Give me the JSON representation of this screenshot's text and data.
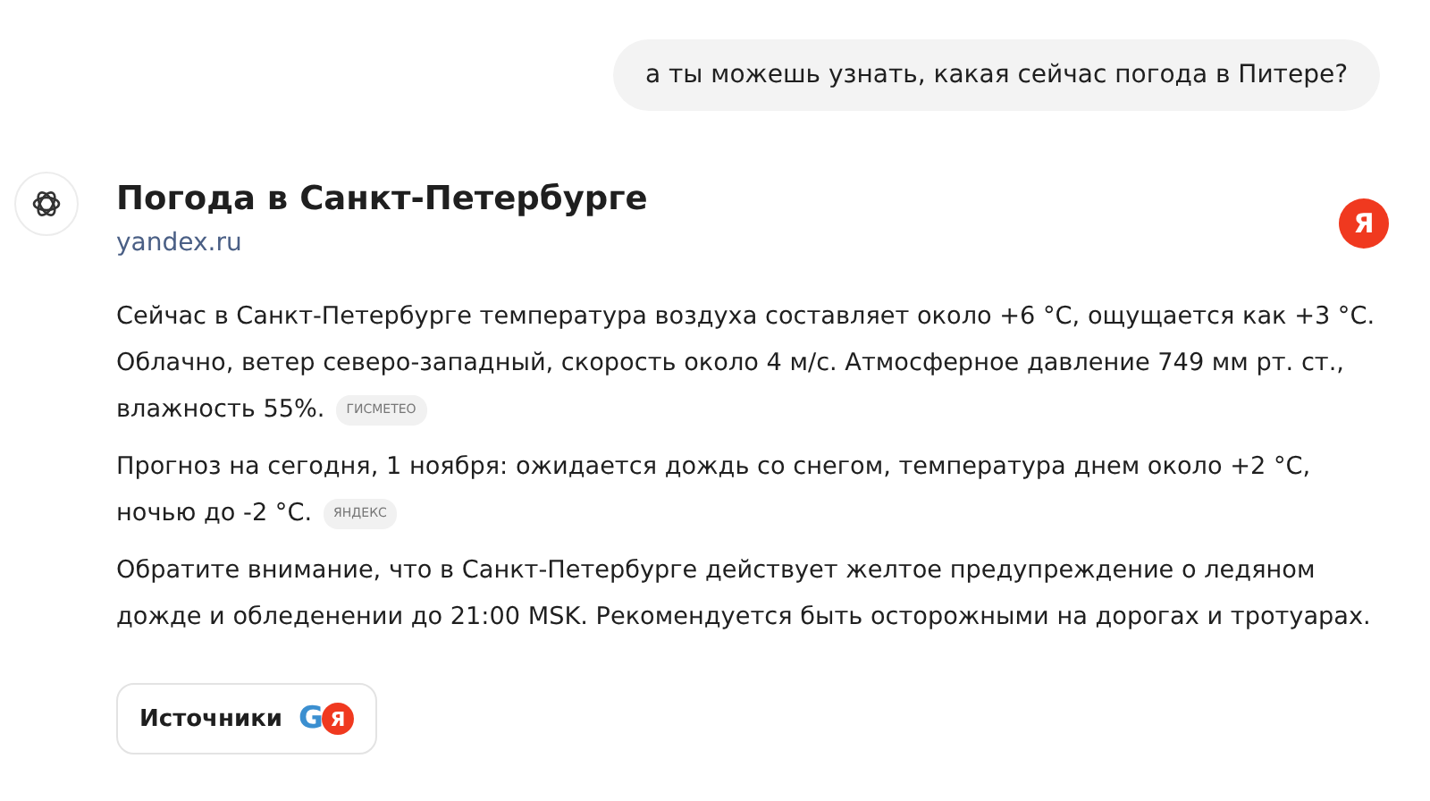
{
  "user_message": "а ты можешь узнать, какая сейчас погода в Питере?",
  "answer": {
    "title": "Погода в Санкт-Петербурге",
    "source_link": "yandex.ru",
    "source_logo": "Я",
    "paragraphs": [
      {
        "lines": [
          "Сейчас в Санкт-Петербурге температура воздуха составляет около +6 °C, ощущается как +3 °C.",
          "Облачно, ветер северо-западный, скорость около 4 м/с. Атмосферное давление 749 мм рт. ст.,",
          "влажность 55%."
        ],
        "badge": "ГИСМЕТЕО"
      },
      {
        "lines": [
          "Прогноз на сегодня, 1 ноября: ожидается дождь со снегом, температура днем около +2 °C,",
          "ночью до -2 °C."
        ],
        "badge": "ЯНДЕКС"
      },
      {
        "lines": [
          "Обратите внимание, что в Санкт-Петербурге действует желтое предупреждение о ледяном",
          "дожде и обледенении до 21:00 MSK. Рекомендуется быть осторожными на дорогах и тротуарах."
        ]
      }
    ],
    "sources_button": {
      "label": "Источники",
      "icons": [
        "G",
        "Я"
      ]
    }
  }
}
